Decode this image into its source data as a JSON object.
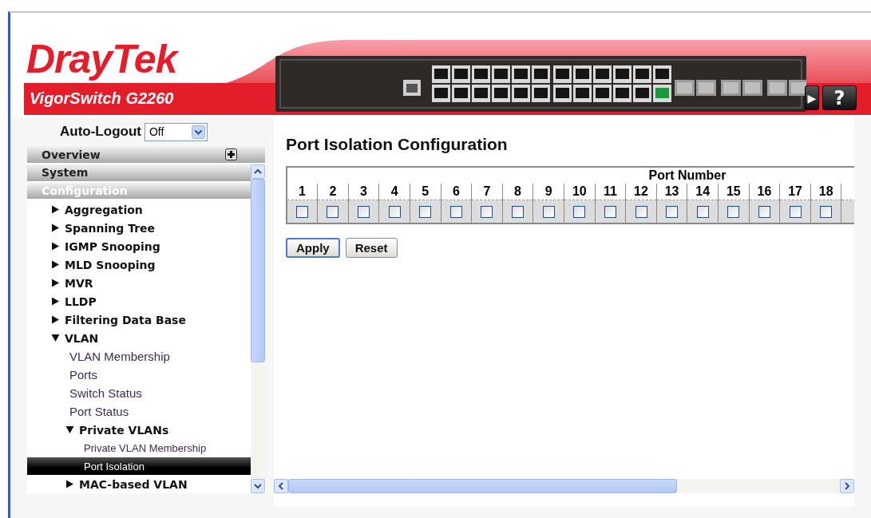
{
  "header": {
    "brand": "DrayTek",
    "model": "VigorSwitch G2260",
    "buttons": [
      {
        "label": "▶"
      },
      {
        "label": "?"
      }
    ]
  },
  "auto_logout": {
    "label": "Auto-Logout",
    "value": "Off"
  },
  "sidebar": {
    "sections": [
      {
        "label": "Overview",
        "selected": false,
        "expanded": false
      },
      {
        "label": "System",
        "selected": false
      },
      {
        "label": "Configuration",
        "selected": true,
        "children": [
          {
            "kind": "folder",
            "label": "Aggregation",
            "expanded": false
          },
          {
            "kind": "folder",
            "label": "Spanning Tree",
            "expanded": false
          },
          {
            "kind": "folder",
            "label": "IGMP Snooping",
            "expanded": false
          },
          {
            "kind": "folder",
            "label": "MLD Snooping",
            "expanded": false
          },
          {
            "kind": "folder",
            "label": "MVR",
            "expanded": false
          },
          {
            "kind": "folder",
            "label": "LLDP",
            "expanded": false
          },
          {
            "kind": "folder",
            "label": "Filtering Data Base",
            "expanded": false
          },
          {
            "kind": "folder",
            "label": "VLAN",
            "expanded": true,
            "children": [
              {
                "kind": "page",
                "label": "VLAN Membership",
                "selected": false
              },
              {
                "kind": "page",
                "label": "Ports",
                "selected": false
              },
              {
                "kind": "page",
                "label": "Switch Status",
                "selected": false
              },
              {
                "kind": "page",
                "label": "Port Status",
                "selected": false
              },
              {
                "kind": "folder",
                "label": "Private VLANs",
                "expanded": true,
                "children": [
                  {
                    "kind": "page",
                    "label": "Private VLAN Membership",
                    "selected": false
                  },
                  {
                    "kind": "page",
                    "label": "Port Isolation",
                    "selected": true
                  }
                ]
              },
              {
                "kind": "folder",
                "label": "MAC-based VLAN",
                "expanded": false
              }
            ]
          }
        ]
      }
    ]
  },
  "main": {
    "title": "Port Isolation Configuration",
    "table": {
      "group_header": "Port Number",
      "ports": [
        {
          "label": "1",
          "checked": false
        },
        {
          "label": "2",
          "checked": false
        },
        {
          "label": "3",
          "checked": false
        },
        {
          "label": "4",
          "checked": false
        },
        {
          "label": "5",
          "checked": false
        },
        {
          "label": "6",
          "checked": false
        },
        {
          "label": "7",
          "checked": false
        },
        {
          "label": "8",
          "checked": false
        },
        {
          "label": "9",
          "checked": false
        },
        {
          "label": "10",
          "checked": false
        },
        {
          "label": "11",
          "checked": false
        },
        {
          "label": "12",
          "checked": false
        },
        {
          "label": "13",
          "checked": false
        },
        {
          "label": "14",
          "checked": false
        },
        {
          "label": "15",
          "checked": false
        },
        {
          "label": "16",
          "checked": false
        },
        {
          "label": "17",
          "checked": false
        },
        {
          "label": "18",
          "checked": false
        }
      ]
    },
    "buttons": [
      {
        "label": "Apply",
        "focused": true
      },
      {
        "label": "Reset",
        "focused": false
      }
    ]
  }
}
